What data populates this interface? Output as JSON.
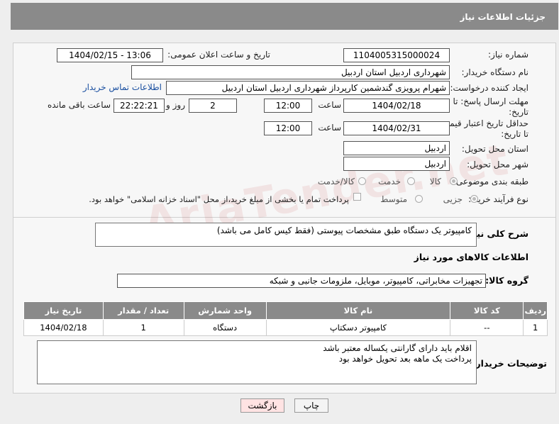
{
  "header": {
    "title": "جزئیات اطلاعات نیاز"
  },
  "form": {
    "need_number_label": "شماره نیاز:",
    "need_number": "1104005315000024",
    "announce_label": "تاریخ و ساعت اعلان عمومی:",
    "announce_value": "1404/02/15 - 13:06",
    "buyer_org_label": "نام دستگاه خریدار:",
    "buyer_org": "شهرداری اردبیل استان اردبیل",
    "creator_label": "ایجاد کننده درخواست:",
    "creator": "شهرام پرویزی گندشمین کارپرداز شهرداری اردبیل استان اردبیل",
    "contact_link": "اطلاعات تماس خریدار",
    "deadline_label_1": "مهلت ارسال پاسخ: تا",
    "deadline_label_2": "تاریخ:",
    "deadline_date": "1404/02/18",
    "time_label": "ساعت",
    "deadline_time": "12:00",
    "days_value": "2",
    "days_label": "روز و",
    "remaining_time": "22:22:21",
    "remaining_label": "ساعت باقی مانده",
    "validity_label_1": "حداقل تاریخ اعتبار قیمت:",
    "validity_label_2": "تا تاریخ:",
    "validity_date": "1404/02/31",
    "validity_time": "12:00",
    "province_label": "استان محل تحویل:",
    "province": "اردبیل",
    "city_label": "شهر محل تحویل:",
    "city": "اردبیل",
    "category_label": "طبقه بندی موضوعی:",
    "category_options": [
      "کالا",
      "خدمت",
      "کالا/خدمت"
    ],
    "purchase_type_label": "نوع فرآیند خرید :",
    "purchase_options": [
      "جزیی",
      "متوسط"
    ],
    "payment_note": "پرداخت تمام یا بخشی از مبلغ خرید،از محل \"اسناد خزانه اسلامی\" خواهد بود."
  },
  "description": {
    "label": "شرح کلی نیاز:",
    "text": "کامپیوتر یک دستگاه طبق مشخصات پیوستی (فقط کیس کامل می باشد)"
  },
  "goods": {
    "section_title": "اطلاعات کالاهای مورد نیاز",
    "group_label": "گروه کالا:",
    "group_value": "تجهیزات مخابراتی، کامپیوتر، موبایل، ملزومات جانبی و شبکه",
    "columns": [
      "ردیف",
      "کد کالا",
      "نام کالا",
      "واحد شمارش",
      "تعداد / مقدار",
      "تاریخ نیاز"
    ],
    "rows": [
      [
        "1",
        "--",
        "کامپیوتر دسکتاپ",
        "دستگاه",
        "1",
        "1404/02/18"
      ]
    ]
  },
  "buyer_notes": {
    "label": "توضیحات خریدار:",
    "line1": "اقلام باید دارای گارانتی یکساله معتبر باشد",
    "line2": "پرداخت یک ماهه بعد تحویل خواهد بود"
  },
  "buttons": {
    "print": "چاپ",
    "back": "بازگشت"
  },
  "colors": {
    "header_bg": "#8a8a8a",
    "link": "#1a4fa0",
    "back_button_bg": "#ffe3e3"
  }
}
